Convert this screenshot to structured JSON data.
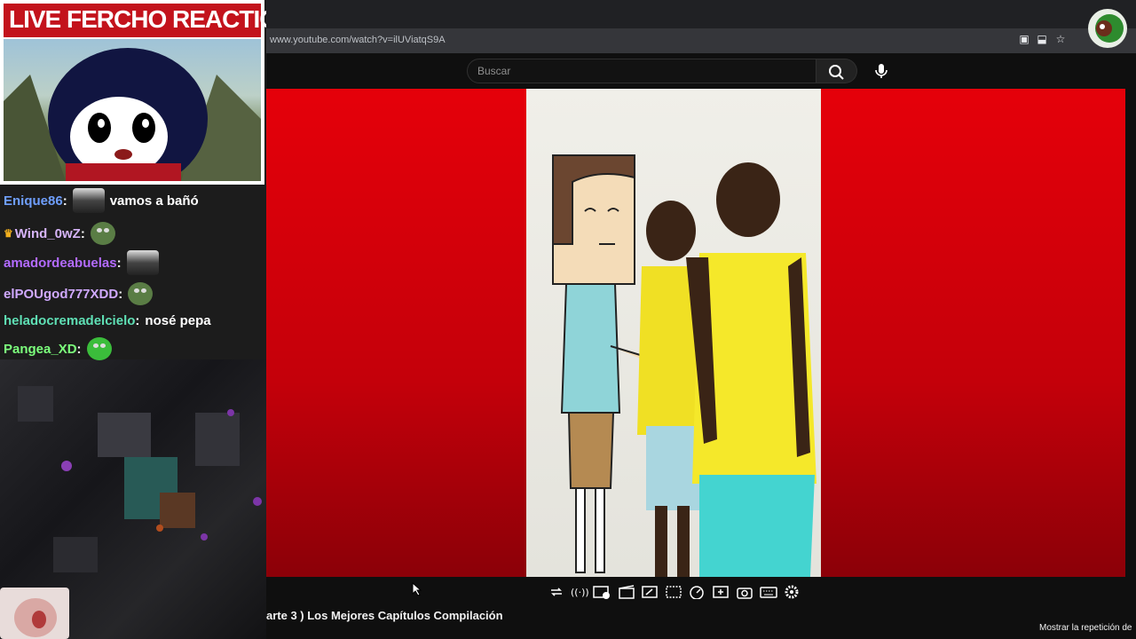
{
  "overlay": {
    "title": "LIVE FERCHO REACTION"
  },
  "chat": [
    {
      "user": "Enique86",
      "separator": ":",
      "message": "vamos a bañó",
      "user_color": "#6f9fff",
      "emote": "car-emote"
    },
    {
      "user": "Wind_0wZ",
      "separator": ":",
      "message": "",
      "user_color": "#d6b4f8",
      "emote": "pepe-emote",
      "badge": "crown-icon"
    },
    {
      "user": "amadordeabuelas",
      "separator": ":",
      "message": "",
      "user_color": "#b36bff",
      "emote": "car-emote"
    },
    {
      "user": "elPOUgod777XDD",
      "separator": ":",
      "message": "",
      "user_color": "#d0a9ff",
      "emote": "pepe-emote"
    },
    {
      "user": "heladocremadelcielo",
      "separator": ":",
      "message": "nosé pepa",
      "user_color": "#5fe0b5",
      "emote": ""
    },
    {
      "user": "Pangea_XD",
      "separator": ":",
      "message": "",
      "user_color": "#7cff7c",
      "emote": "pepe-love-emote"
    }
  ],
  "browser": {
    "url": "www.youtube.com/watch?v=ilUViatqS9A"
  },
  "youtube": {
    "search_placeholder": "Buscar",
    "video_title": "arte 3 ) Los Mejores Capítulos Compilación",
    "replay_text": "Mostrar la repetición de"
  },
  "colors": {
    "video_red": "#d2000a",
    "banner_red": "#c3131c"
  },
  "icons": [
    "repeat-icon",
    "surround-icon",
    "picture-icon",
    "clapper-icon",
    "resize-icon",
    "subtitles-icon",
    "speed-icon",
    "add-icon",
    "camera-icon",
    "keyboard-icon",
    "settings-icon"
  ]
}
